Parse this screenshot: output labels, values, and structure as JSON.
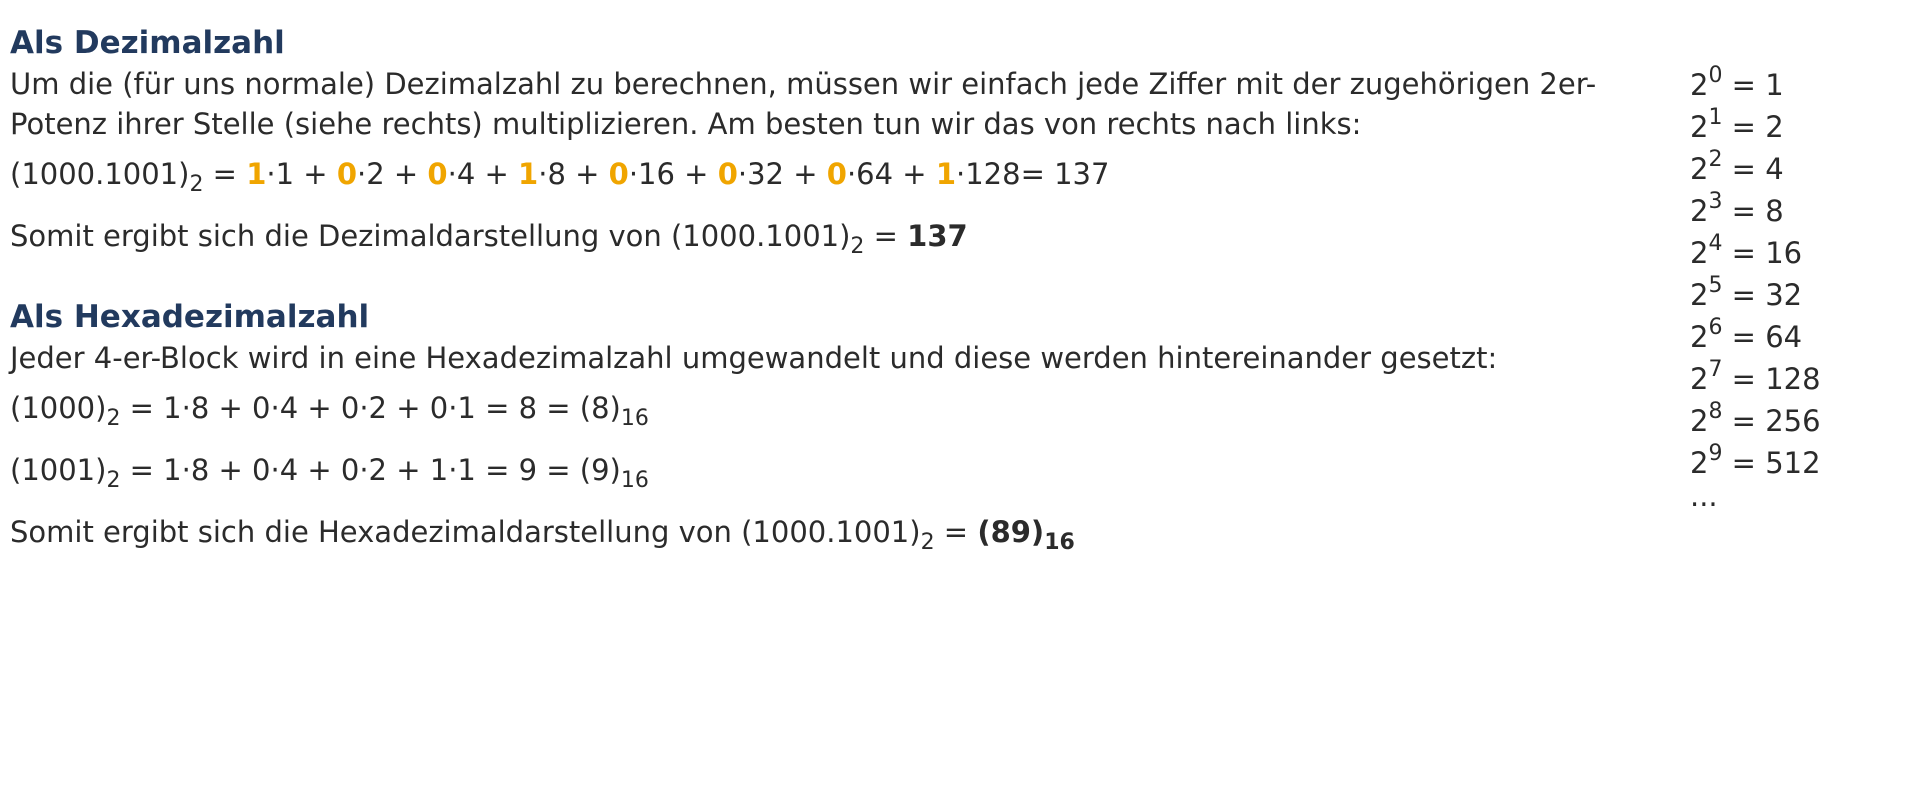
{
  "section_decimal": {
    "heading": "Als Dezimalzahl",
    "intro": "Um die (für uns normale) Dezimalzahl zu berechnen, müssen wir einfach jede Ziffer mit der zugehörigen 2er-Potenz ihrer Stelle (siehe rechts) multiplizieren. Am besten tun wir das von rechts nach links:",
    "equation": {
      "lhs_value": "(1000.1001)",
      "lhs_base": "2",
      "terms": [
        {
          "digit": "1",
          "factor": "1",
          "sep": " + "
        },
        {
          "digit": "0",
          "factor": "2",
          "sep": " + "
        },
        {
          "digit": "0",
          "factor": "4",
          "sep": " + "
        },
        {
          "digit": "1",
          "factor": "8",
          "sep": " + "
        },
        {
          "digit": "0",
          "factor": "16",
          "sep": " + "
        },
        {
          "digit": "0",
          "factor": "32",
          "sep": " + "
        },
        {
          "digit": "0",
          "factor": "64",
          "sep": " + "
        },
        {
          "digit": "1",
          "factor": "128",
          "sep": ""
        }
      ],
      "result": "= 137"
    },
    "result_text": "Somit ergibt sich die Dezimaldarstellung von ",
    "result_value": "(1000.1001)",
    "result_base": "2",
    "result_final": "137"
  },
  "section_hex": {
    "heading": "Als Hexadezimalzahl",
    "intro": "Jeder 4-er-Block wird in eine Hexadezimalzahl umgewandelt und diese werden hintereinander gesetzt:",
    "blocks": [
      {
        "value": "(1000)",
        "base": "2",
        "expr": " = 1·8 + 0·4 + 0·2 + 0·1 = 8 = (8)",
        "hex_base": "16"
      },
      {
        "value": "(1001)",
        "base": "2",
        "expr": " = 1·8 + 0·4 + 0·2 + 1·1 = 9 = (9)",
        "hex_base": "16"
      }
    ],
    "result_text": "Somit ergibt sich die Hexadezimaldarstellung von ",
    "result_value": "(1000.1001)",
    "result_base": "2",
    "result_final": "(89)",
    "result_final_base": "16"
  },
  "powers": {
    "base": "2",
    "rows": [
      {
        "exp": "0",
        "value": "= 1"
      },
      {
        "exp": "1",
        "value": "= 2"
      },
      {
        "exp": "2",
        "value": "= 4"
      },
      {
        "exp": "3",
        "value": "= 8"
      },
      {
        "exp": "4",
        "value": "= 16"
      },
      {
        "exp": "5",
        "value": "= 32"
      },
      {
        "exp": "6",
        "value": "= 64"
      },
      {
        "exp": "7",
        "value": "= 128"
      },
      {
        "exp": "8",
        "value": "= 256"
      },
      {
        "exp": "9",
        "value": "= 512"
      }
    ],
    "ellipsis": "..."
  }
}
